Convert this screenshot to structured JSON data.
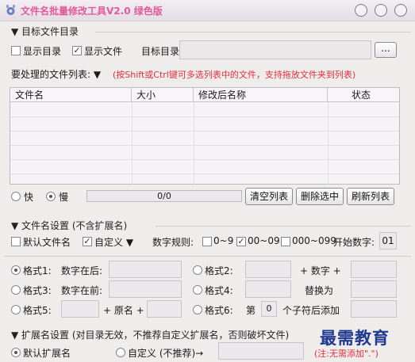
{
  "window": {
    "title": "文件名批量修改工具V2.0  绿色版"
  },
  "target": {
    "section_title": "▼ 目标文件目录",
    "show_dir_label": "显示目录",
    "show_file_label": "显示文件",
    "target_dir_label": "目标目录:",
    "target_dir_value": "",
    "browse_label": "...",
    "file_list_label": "要处理的文件列表: ▼",
    "file_list_hint": "(按Shift或Ctrl键可多选列表中的文件，支持拖放文件夹到列表)"
  },
  "table": {
    "columns": [
      "文件名",
      "大小",
      "修改后名称",
      "状态"
    ],
    "rows": []
  },
  "speed": {
    "fast_label": "快",
    "slow_label": "慢",
    "progress_text": "0/0"
  },
  "buttons": {
    "clear": "清空列表",
    "delete_selected": "删除选中",
    "refresh": "刷新列表"
  },
  "name_settings": {
    "section_title": "▼ 文件名设置 (不含扩展名)",
    "default_label": "默认文件名",
    "custom_label": "自定义 ▼",
    "digit_rule_label": "数字规则:",
    "rule1": "0~9",
    "rule2": "00~09",
    "rule3": "000~099",
    "start_label": "开始数字:",
    "start_value": "01"
  },
  "formats": {
    "f1": "格式1:",
    "f1_desc": "数字在后:",
    "f2": "格式2:",
    "f2_plus": "+ 数字 +",
    "f3": "格式3:",
    "f3_desc": "数字在前:",
    "f4": "格式4:",
    "f4_desc": "替换为",
    "f5": "格式5:",
    "f5_mid": "+ 原名 +",
    "f6": "格式6:",
    "f6_prefix": "第",
    "f6_value": "0",
    "f6_suffix": "个子符后添加"
  },
  "ext_settings": {
    "section_title": "▼ 扩展名设置 (对目录无效，不推荐自定义扩展名，否则破坏文件)",
    "default_label": "默认扩展名",
    "custom_label": "自定义 (不推荐)→"
  },
  "watermark": {
    "text": "最需教育",
    "note": "(注:无需添加\".\")"
  },
  "colors": {
    "title": "#e25a9c",
    "hint": "#e0303a",
    "watermark": "#1f3a8f"
  }
}
